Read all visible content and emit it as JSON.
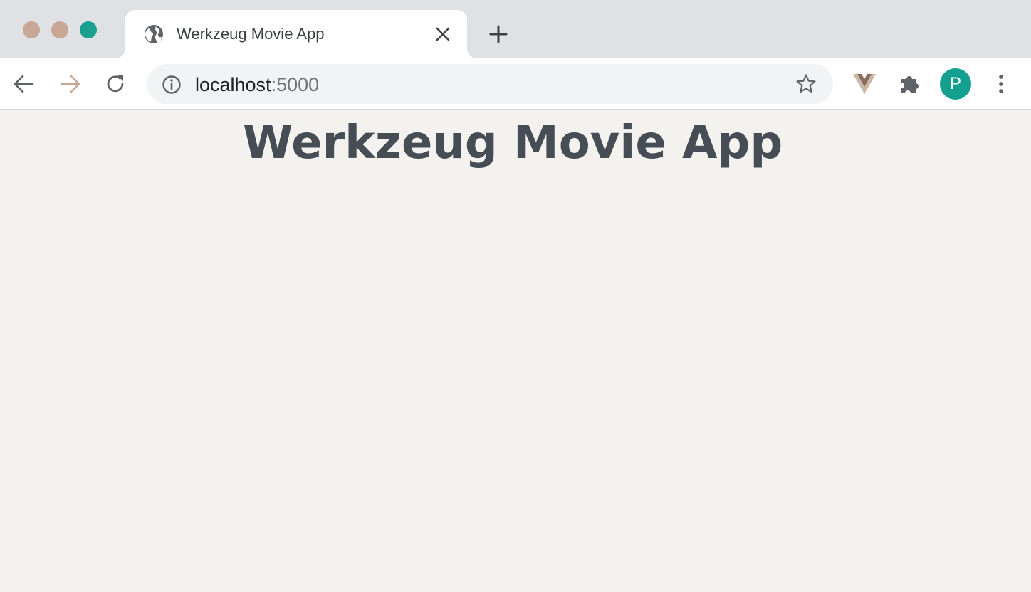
{
  "browser": {
    "tab": {
      "title": "Werkzeug Movie App",
      "favicon": "globe-icon"
    },
    "address_bar": {
      "host": "localhost",
      "port": ":5000"
    },
    "profile_initial": "P",
    "colors": {
      "accent": "#13a08f",
      "traffic_close": "#c9a795",
      "traffic_minimize": "#c9a795",
      "traffic_maximize": "#1aa08f"
    },
    "icons": [
      "back-arrow-icon",
      "forward-arrow-icon",
      "reload-icon",
      "info-icon",
      "star-icon",
      "extension-v-icon",
      "puzzle-icon",
      "kebab-menu-icon",
      "new-tab-icon",
      "close-icon"
    ]
  },
  "page": {
    "heading": "Werkzeug Movie App",
    "background": "#f3f2ee",
    "heading_color": "#474d55"
  }
}
